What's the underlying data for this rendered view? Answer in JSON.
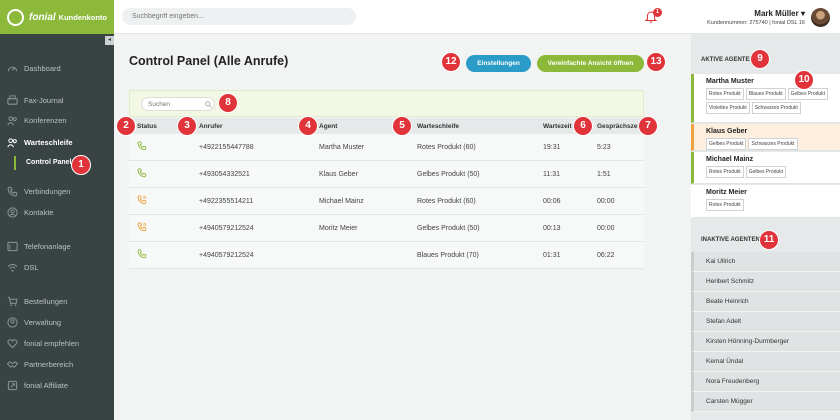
{
  "brand": {
    "name": "fonial",
    "subtitle": "Kundenkonto"
  },
  "topbar": {
    "search_placeholder": "Suchbegriff eingeben...",
    "notification_count": "1",
    "user_name": "Mark Müller",
    "customer_number": "Kundennummer: 275740 | fonial DSL 16"
  },
  "sidebar": {
    "items": [
      {
        "label": "Dashboard",
        "icon": "speedometer-icon"
      },
      {
        "label": "Fax-Journal",
        "icon": "fax-icon"
      },
      {
        "label": "Konferenzen",
        "icon": "conference-icon"
      },
      {
        "label": "Warteschleife",
        "icon": "queue-icon"
      },
      {
        "label": "Control Panel"
      },
      {
        "label": "Verbindungen",
        "icon": "phone-icon"
      },
      {
        "label": "Kontakte",
        "icon": "contacts-icon"
      },
      {
        "label": "Telefonanlage",
        "icon": "pbx-icon"
      },
      {
        "label": "DSL",
        "icon": "wifi-icon"
      },
      {
        "label": "Bestellungen",
        "icon": "cart-icon"
      },
      {
        "label": "Verwaltung",
        "icon": "user-icon"
      },
      {
        "label": "fonial empfehlen",
        "icon": "heart-icon"
      },
      {
        "label": "Partnerbereich",
        "icon": "handshake-icon"
      },
      {
        "label": "fonial Affiliate",
        "icon": "affiliate-icon"
      }
    ]
  },
  "main": {
    "title": "Control Panel (Alle Anrufe)",
    "settings_button": "Einstellungen",
    "simple_view_button": "Vereinfachte Ansicht öffnen",
    "search_placeholder": "Suchen",
    "columns": [
      "Status",
      "Anrufer",
      "Agent",
      "Warteschleife",
      "Wartezeit",
      "Gesprächszeit"
    ],
    "rows": [
      {
        "status": "active",
        "caller": "+4922155447788",
        "agent": "Martha Muster",
        "queue": "Rotes Produkt (60)",
        "wait": "19:31",
        "talk": "5:23"
      },
      {
        "status": "active",
        "caller": "+493054332521",
        "agent": "Klaus Geber",
        "queue": "Gelbes Produkt (50)",
        "wait": "11:31",
        "talk": "1:51"
      },
      {
        "status": "ringing",
        "caller": "+4922355514211",
        "agent": "Michael Mainz",
        "queue": "Rotes Produkt (60)",
        "wait": "00:06",
        "talk": "00:00"
      },
      {
        "status": "ringing",
        "caller": "+4940579212524",
        "agent": "Moritz Meier",
        "queue": "Gelbes Produkt (50)",
        "wait": "00:13",
        "talk": "00:00"
      },
      {
        "status": "active",
        "caller": "+4940579212524",
        "agent": "",
        "queue": "Blaues Produkt (70)",
        "wait": "01:31",
        "talk": "06:22"
      }
    ]
  },
  "right": {
    "active_title": "AKTIVE AGENTEN",
    "active_agents": [
      {
        "name": "Martha Muster",
        "tags": [
          "Rotes Produkt",
          "Blaues Produkt",
          "Gelbes Produkt",
          "Violettes Produkt",
          "Schwarzes Produkt"
        ],
        "state": "available",
        "color": "#8cb93a"
      },
      {
        "name": "Klaus Geber",
        "tags": [
          "Gelbes Produkt",
          "Schwarzes Produkt"
        ],
        "state": "busy",
        "color": "#f0a040"
      },
      {
        "name": "Michael Mainz",
        "tags": [
          "Rotes Produkt",
          "Gelbes Produkt"
        ],
        "state": "available",
        "color": "#8cb93a"
      },
      {
        "name": "Moritz Meier",
        "tags": [
          "Rotes Produkt"
        ],
        "state": "idle",
        "color": "#ffffff"
      }
    ],
    "inactive_title": "INAKTIVE AGENTEN",
    "inactive_agents": [
      "Kai Ullrich",
      "Heribert Schmitz",
      "Beate Heinrich",
      "Stefan Adelt",
      "Kirsten Hönning-Durmberger",
      "Kemal Ündal",
      "Nora Freudenberg",
      "Carsten Mügger"
    ]
  },
  "callouts": [
    "1",
    "2",
    "3",
    "4",
    "5",
    "6",
    "7",
    "8",
    "9",
    "10",
    "11",
    "12",
    "13"
  ],
  "colors": {
    "brand_green": "#8cb93a",
    "accent_blue": "#2b9bc7",
    "callout_red": "#e0343a",
    "busy_orange": "#f0a040"
  }
}
